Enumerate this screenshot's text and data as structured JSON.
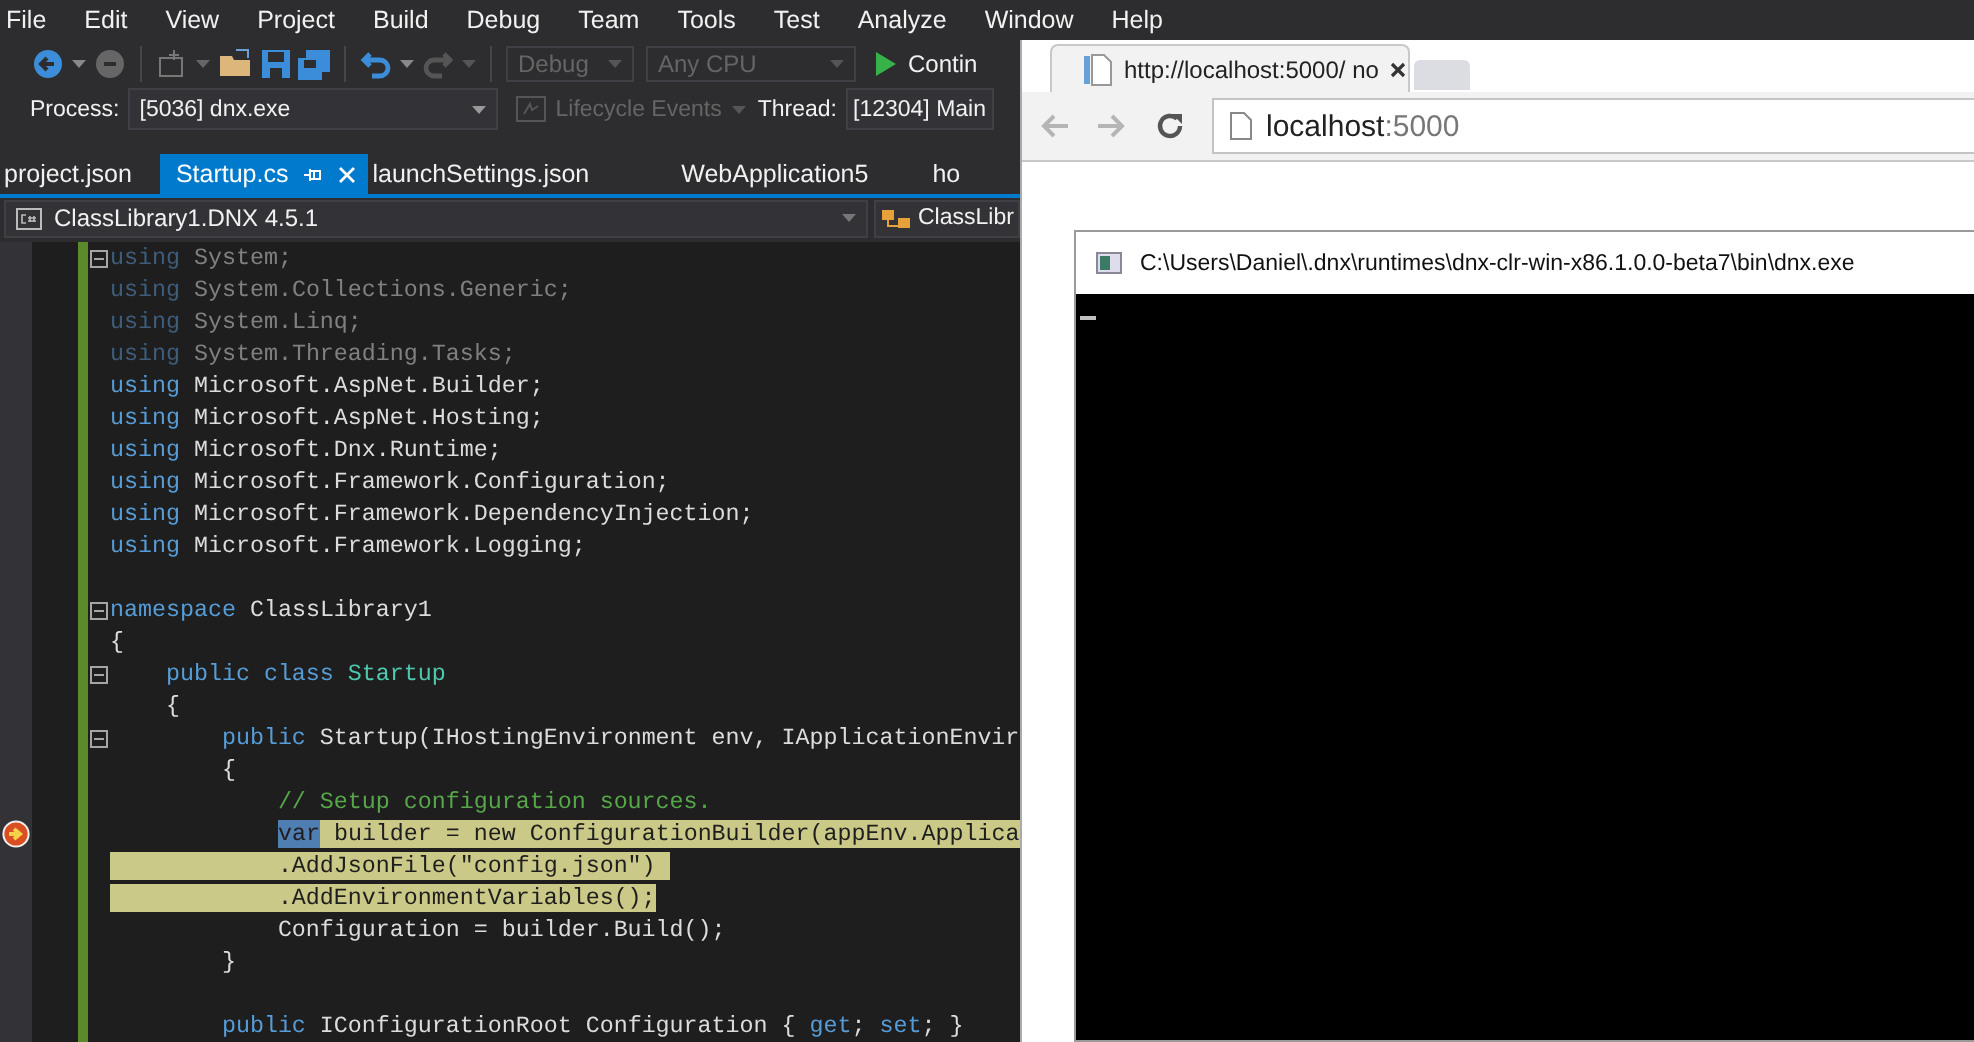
{
  "menu": [
    "File",
    "Edit",
    "View",
    "Project",
    "Build",
    "Debug",
    "Team",
    "Tools",
    "Test",
    "Analyze",
    "Window",
    "Help"
  ],
  "toolbar": {
    "configuration": {
      "value": "Debug",
      "disabled": true
    },
    "platform": {
      "value": "Any CPU",
      "disabled": true
    },
    "run_button": "Contin"
  },
  "debug_bar": {
    "process_label": "Process:",
    "process": "[5036] dnx.exe",
    "lifecycle": {
      "label": "Lifecycle Events",
      "disabled": true
    },
    "thread_label": "Thread:",
    "thread": "[12304] Main"
  },
  "tabs": [
    {
      "label": "project.json",
      "selected": false
    },
    {
      "label": "Startup.cs",
      "selected": true
    },
    {
      "label": "launchSettings.json",
      "selected": false
    },
    {
      "label": "WebApplication5",
      "selected": false
    },
    {
      "label": "ho",
      "selected": false
    }
  ],
  "navigation_bar": {
    "project": "ClassLibrary1.DNX 4.5.1",
    "member": "ClassLibr"
  },
  "editor": {
    "lines": [
      {
        "fold": true,
        "current": false,
        "segments": [
          {
            "text": "using",
            "kind": "dim_keyword"
          },
          {
            "text": " System;",
            "kind": "dim"
          }
        ]
      },
      {
        "fold": false,
        "current": false,
        "segments": [
          {
            "text": "using",
            "kind": "dim_keyword"
          },
          {
            "text": " System.Collections.Generic;",
            "kind": "dim"
          }
        ]
      },
      {
        "fold": false,
        "current": false,
        "segments": [
          {
            "text": "using",
            "kind": "dim_keyword"
          },
          {
            "text": " System.Linq;",
            "kind": "dim"
          }
        ]
      },
      {
        "fold": false,
        "current": false,
        "segments": [
          {
            "text": "using",
            "kind": "dim_keyword"
          },
          {
            "text": " System.Threading.Tasks;",
            "kind": "dim"
          }
        ]
      },
      {
        "fold": false,
        "current": false,
        "segments": [
          {
            "text": "using",
            "kind": "keyword"
          },
          {
            "text": " Microsoft.AspNet.Builder;",
            "kind": "plain"
          }
        ]
      },
      {
        "fold": false,
        "current": false,
        "segments": [
          {
            "text": "using",
            "kind": "keyword"
          },
          {
            "text": " Microsoft.AspNet.Hosting;",
            "kind": "plain"
          }
        ]
      },
      {
        "fold": false,
        "current": false,
        "segments": [
          {
            "text": "using",
            "kind": "keyword"
          },
          {
            "text": " Microsoft.Dnx.Runtime;",
            "kind": "plain"
          }
        ]
      },
      {
        "fold": false,
        "current": false,
        "segments": [
          {
            "text": "using",
            "kind": "keyword"
          },
          {
            "text": " Microsoft.Framework.Configuration;",
            "kind": "plain"
          }
        ]
      },
      {
        "fold": false,
        "current": false,
        "segments": [
          {
            "text": "using",
            "kind": "keyword"
          },
          {
            "text": " Microsoft.Framework.DependencyInjection;",
            "kind": "plain"
          }
        ]
      },
      {
        "fold": false,
        "current": false,
        "segments": [
          {
            "text": "using",
            "kind": "keyword"
          },
          {
            "text": " Microsoft.Framework.Logging;",
            "kind": "plain"
          }
        ]
      },
      {
        "kind": "blank"
      },
      {
        "fold": true,
        "current": false,
        "segments": [
          {
            "text": "namespace",
            "kind": "keyword"
          },
          {
            "text": " ClassLibrary1",
            "kind": "plain"
          }
        ]
      },
      {
        "fold": false,
        "current": false,
        "segments": [
          {
            "text": "{",
            "kind": "plain"
          }
        ]
      },
      {
        "fold": true,
        "current": false,
        "segments": [
          {
            "text": "    public class",
            "kind": "keyword"
          },
          {
            "text": " Startup",
            "kind": "type"
          }
        ]
      },
      {
        "fold": false,
        "current": false,
        "segments": [
          {
            "text": "    {",
            "kind": "plain"
          }
        ]
      },
      {
        "fold": true,
        "current": false,
        "segments": [
          {
            "text": "        public",
            "kind": "keyword"
          },
          {
            "text": " Startup(IHostingEnvironment env, IApplicationEnvir",
            "kind": "plain"
          }
        ]
      },
      {
        "fold": false,
        "current": false,
        "segments": [
          {
            "text": "        {",
            "kind": "plain"
          }
        ]
      },
      {
        "fold": false,
        "current": false,
        "segments": [
          {
            "text": "            // Setup configuration sources.",
            "kind": "comment"
          }
        ]
      },
      {
        "fold": false,
        "current": true,
        "segments": [
          {
            "text": "            var",
            "kind": "selected"
          },
          {
            "text": " builder = new ConfigurationBuilder(appEnv.Applica",
            "kind": "statement"
          }
        ]
      },
      {
        "fold": false,
        "current": false,
        "segments": [
          {
            "text": "            .AddJsonFile(\"config.json\") ",
            "kind": "statement"
          }
        ]
      },
      {
        "fold": false,
        "current": false,
        "segments": [
          {
            "text": "            .AddEnvironmentVariables();",
            "kind": "statement"
          }
        ]
      },
      {
        "fold": false,
        "current": false,
        "segments": [
          {
            "text": "            Configuration = builder.Build();",
            "kind": "plain"
          }
        ]
      },
      {
        "fold": false,
        "current": false,
        "segments": [
          {
            "text": "        }",
            "kind": "plain"
          }
        ]
      },
      {
        "kind": "blank"
      },
      {
        "fold": false,
        "current": false,
        "segments": [
          {
            "text": "        public",
            "kind": "keyword"
          },
          {
            "text": " IConfigurationRoot Configuration { ",
            "kind": "plain"
          },
          {
            "text": "get",
            "kind": "keyword"
          },
          {
            "text": "; ",
            "kind": "plain"
          },
          {
            "text": "set",
            "kind": "keyword"
          },
          {
            "text": "; }",
            "kind": "plain"
          }
        ]
      }
    ]
  },
  "browser": {
    "tab_title": "http://localhost:5000/ no",
    "address": {
      "host": "localhost",
      "port": ":5000"
    },
    "console": {
      "title": "C:\\Users\\Daniel\\.dnx\\runtimes\\dnx-clr-win-x86.1.0.0-beta7\\bin\\dnx.exe"
    }
  }
}
